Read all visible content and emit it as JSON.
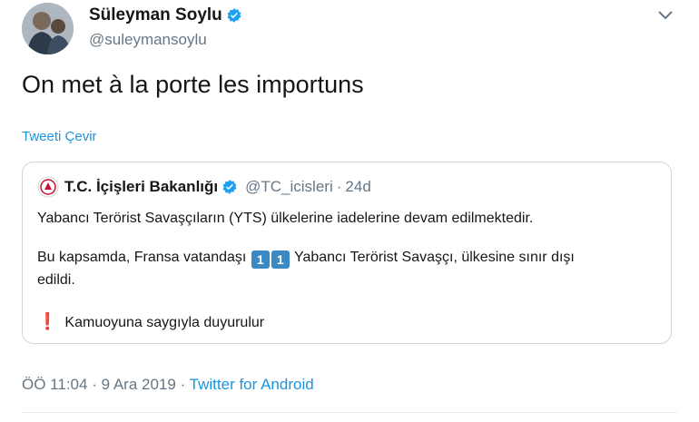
{
  "author": {
    "display_name": "Süleyman Soylu",
    "handle": "@suleymansoylu"
  },
  "tweet": {
    "text": "On met à la porte les importuns",
    "translate_label": "Tweeti Çevir"
  },
  "quoted_tweet": {
    "display_name": "T.C. İçişleri Bakanlığı",
    "handle": "@TC_icisleri",
    "separator": "·",
    "time": "24d",
    "line1": "Yabancı Terörist Savaşçıların (YTS) ülkelerine iadelerine devam edilmektedir.",
    "line2_before": "Bu kapsamda, Fransa vatandaşı",
    "keycap1": "1",
    "keycap2": "1",
    "line2_after": "Yabancı Terörist Savaşçı, ülkesine sınır dışı",
    "line3": "edildi.",
    "exclamation": "❗",
    "line4": "Kamuoyuna saygıyla duyurulur"
  },
  "meta": {
    "time": "ÖÖ 11:04",
    "separator1": "·",
    "date": "9 Ara 2019",
    "separator2": "·",
    "client": "Twitter for Android"
  },
  "colors": {
    "link": "#1b95e0",
    "secondary_text": "#657786",
    "border": "#ccd6dd",
    "verified": "#1da1f2",
    "keycap": "#3b88c3",
    "exclamation": "#dd2e44"
  },
  "icons": [
    "avatar",
    "verified-badge-icon",
    "chevron-down-icon",
    "ministry-logo-icon",
    "keycap-one-icon",
    "exclamation-icon"
  ]
}
